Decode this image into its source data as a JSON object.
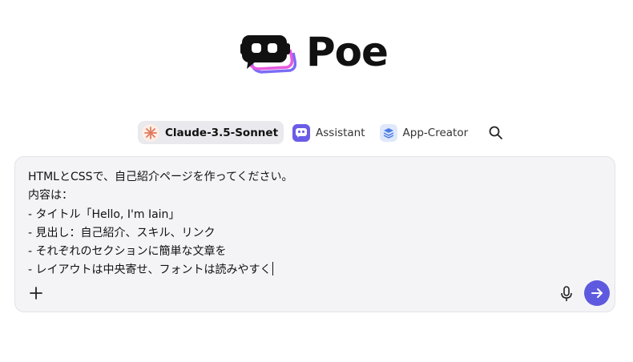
{
  "brand": {
    "name": "Poe"
  },
  "bots": [
    {
      "label": "Claude-3.5-Sonnet",
      "icon": "claude-starburst-icon",
      "active": true
    },
    {
      "label": "Assistant",
      "icon": "assistant-bot-icon",
      "active": false
    },
    {
      "label": "App-Creator",
      "icon": "app-creator-icon",
      "active": false
    }
  ],
  "composer": {
    "lines": [
      "HTMLとCSSで、自己紹介ページを作ってください。",
      "内容は：",
      "- タイトル「Hello, I'm Iain」",
      "- 見出し：自己紹介、スキル、リンク",
      "- それぞれのセクションに簡単な文章を",
      "- レイアウトは中央寄せ、フォントは読みやすく"
    ]
  },
  "colors": {
    "accent": "#5e5ae0",
    "composer_bg": "#f4f4f7",
    "active_bot_bg": "#e9e9ee"
  }
}
